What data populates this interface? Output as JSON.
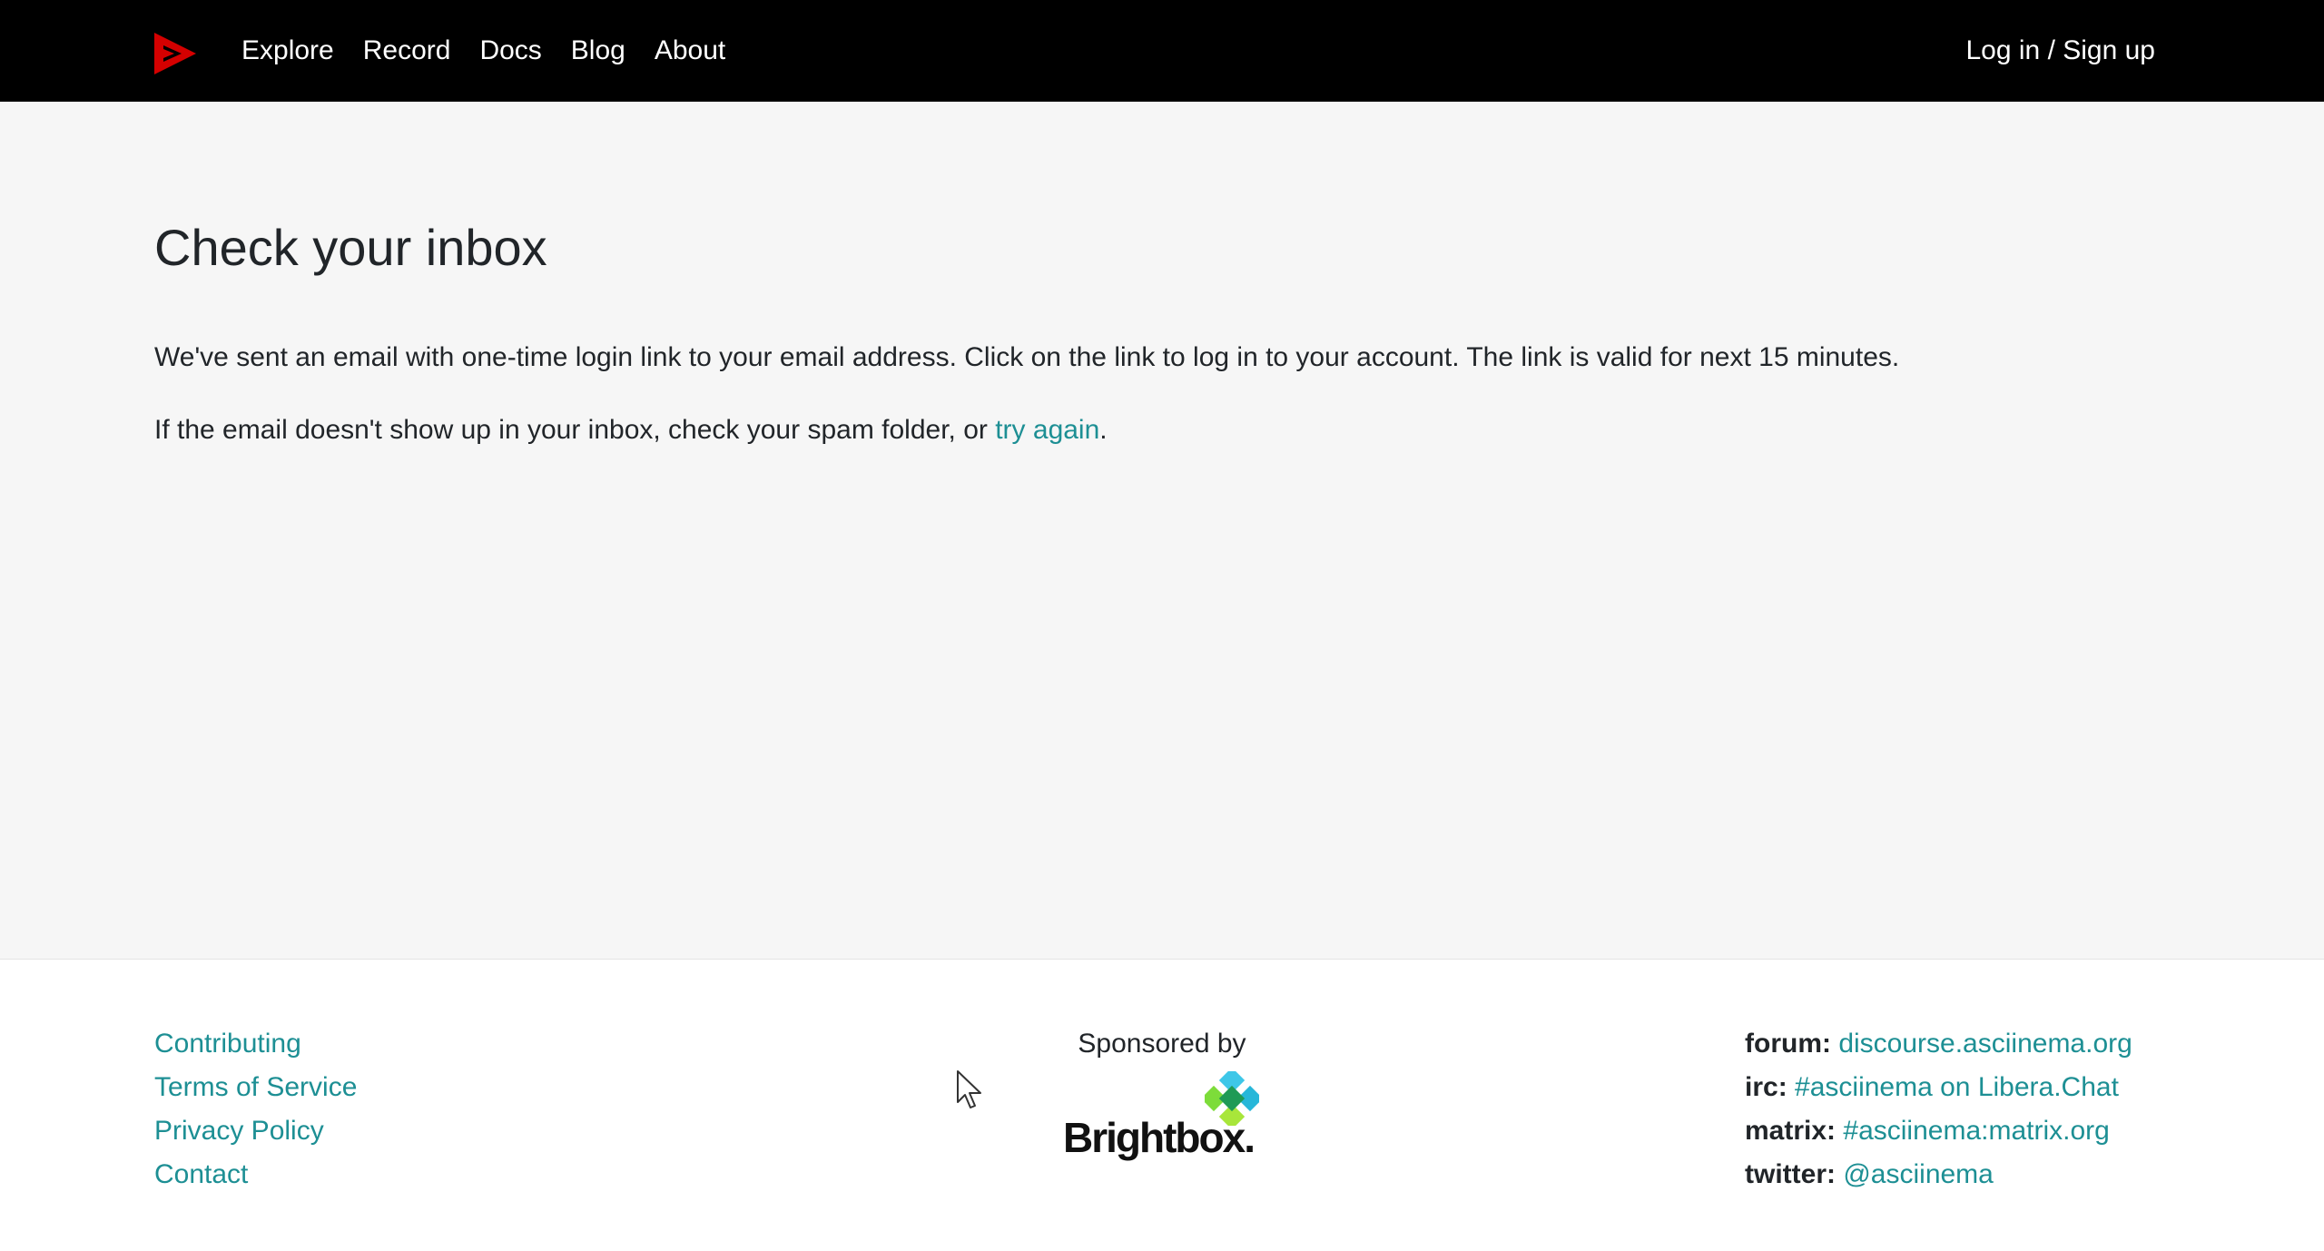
{
  "header": {
    "logo_icon": "asciinema-play-logo-icon",
    "nav": [
      {
        "label": "Explore"
      },
      {
        "label": "Record"
      },
      {
        "label": "Docs"
      },
      {
        "label": "Blog"
      },
      {
        "label": "About"
      }
    ],
    "login_label": "Log in / Sign up"
  },
  "main": {
    "title": "Check your inbox",
    "paragraph1": "We've sent an email with one-time login link to your email address. Click on the link to log in to your account. The link is valid for next 15 minutes.",
    "paragraph2_before": "If the email doesn't show up in your inbox, check your spam folder, or ",
    "paragraph2_link": "try again",
    "paragraph2_after": "."
  },
  "footer": {
    "links": [
      {
        "label": "Contributing"
      },
      {
        "label": "Terms of Service"
      },
      {
        "label": "Privacy Policy"
      },
      {
        "label": "Contact"
      }
    ],
    "sponsor_label": "Sponsored by",
    "sponsor_name": "Brightbox.",
    "community": [
      {
        "label": "forum:",
        "value": "discourse.asciinema.org"
      },
      {
        "label": "irc:",
        "value": "#asciinema on Libera.Chat"
      },
      {
        "label": "matrix:",
        "value": "#asciinema:matrix.org"
      },
      {
        "label": "twitter:",
        "value": "@asciinema"
      }
    ]
  },
  "colors": {
    "header_bg": "#000000",
    "logo_red": "#d40000",
    "link": "#1d8f94",
    "main_bg": "#f6f6f6"
  }
}
